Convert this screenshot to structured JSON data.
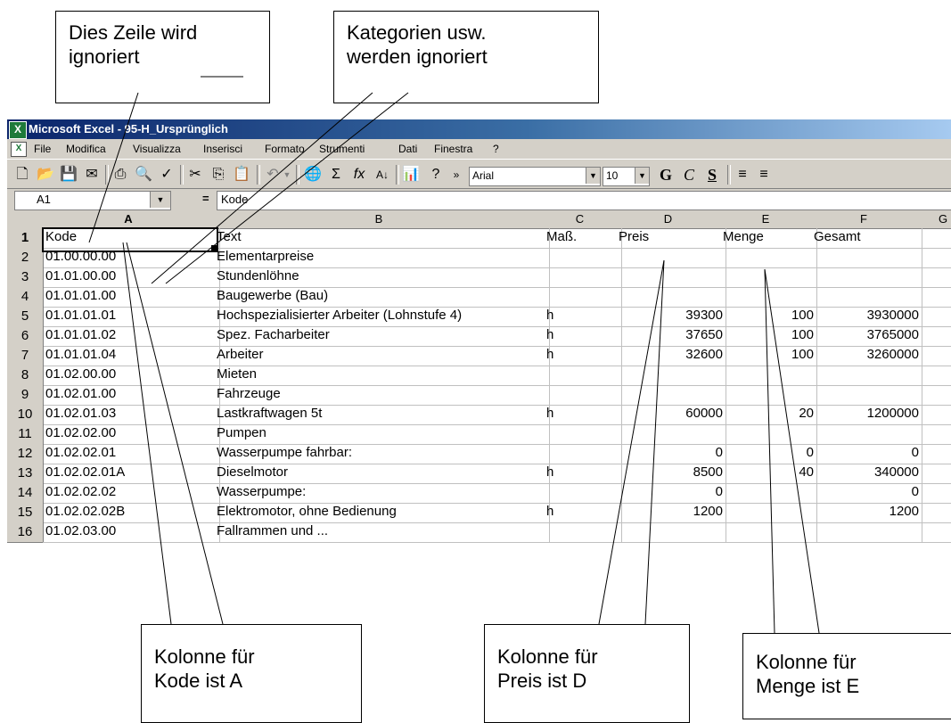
{
  "window": {
    "title": "Microsoft Excel - 95-H_Ursprünglich"
  },
  "menu": [
    "File",
    "Modifica",
    "Visualizza",
    "Inserisci",
    "Formato",
    "Strumenti",
    "Dati",
    "Finestra",
    "?"
  ],
  "toolbar": {
    "font": "Arial",
    "font_size": "10",
    "bold": "G",
    "italic": "C",
    "underline": "S"
  },
  "formula_bar": {
    "name_box": "A1",
    "equals": "=",
    "content": "Kode"
  },
  "columns": [
    "A",
    "B",
    "C",
    "D",
    "E",
    "F",
    "G"
  ],
  "rows": [
    {
      "n": "1",
      "a": "Kode",
      "b": "Text",
      "c": "Maß.",
      "d": "Preis",
      "e": "Menge",
      "f": "Gesamt"
    },
    {
      "n": "2",
      "a": "01.00.00.00",
      "b": "Elementarpreise",
      "c": "",
      "d": "",
      "e": "",
      "f": ""
    },
    {
      "n": "3",
      "a": "01.01.00.00",
      "b": "Stundenlöhne",
      "c": "",
      "d": "",
      "e": "",
      "f": ""
    },
    {
      "n": "4",
      "a": "01.01.01.00",
      "b": "Baugewerbe (Bau)",
      "c": "",
      "d": "",
      "e": "",
      "f": ""
    },
    {
      "n": "5",
      "a": "01.01.01.01",
      "b": "Hochspezialisierter Arbeiter (Lohnstufe 4)",
      "c": "h",
      "d": "39300",
      "e": "100",
      "f": "3930000"
    },
    {
      "n": "6",
      "a": "01.01.01.02",
      "b": "Spez. Facharbeiter",
      "c": "h",
      "d": "37650",
      "e": "100",
      "f": "3765000"
    },
    {
      "n": "7",
      "a": "01.01.01.04",
      "b": "Arbeiter",
      "c": "h",
      "d": "32600",
      "e": "100",
      "f": "3260000"
    },
    {
      "n": "8",
      "a": "01.02.00.00",
      "b": "Mieten",
      "c": "",
      "d": "",
      "e": "",
      "f": ""
    },
    {
      "n": "9",
      "a": "01.02.01.00",
      "b": "Fahrzeuge",
      "c": "",
      "d": "",
      "e": "",
      "f": ""
    },
    {
      "n": "10",
      "a": "01.02.01.03",
      "b": "Lastkraftwagen 5t",
      "c": "h",
      "d": "60000",
      "e": "20",
      "f": "1200000"
    },
    {
      "n": "11",
      "a": "01.02.02.00",
      "b": "Pumpen",
      "c": "",
      "d": "",
      "e": "",
      "f": ""
    },
    {
      "n": "12",
      "a": "01.02.02.01",
      "b": "Wasserpumpe fahrbar:",
      "c": "",
      "d": "0",
      "e": "0",
      "f": "0"
    },
    {
      "n": "13",
      "a": "01.02.02.01A",
      "b": "Dieselmotor",
      "c": "h",
      "d": "8500",
      "e": "40",
      "f": "340000"
    },
    {
      "n": "14",
      "a": "01.02.02.02",
      "b": "Wasserpumpe:",
      "c": "",
      "d": "0",
      "e": "",
      "f": "0"
    },
    {
      "n": "15",
      "a": "01.02.02.02B",
      "b": "Elektromotor, ohne Bedienung",
      "c": "h",
      "d": "1200",
      "e": "",
      "f": "1200"
    },
    {
      "n": "16",
      "a": "01.02.03.00",
      "b": "Fallrammen und ...",
      "c": "",
      "d": "",
      "e": "",
      "f": ""
    }
  ],
  "callouts": {
    "row_ignored": "Dies Zeile wird\nignoriert",
    "categories_ignored": "Kategorien usw.\nwerden ignoriert",
    "code_column": "Kolonne für\nKode ist A",
    "price_column": "Kolonne für\nPreis ist D",
    "quantity_column": "Kolonne für\nMenge ist E"
  }
}
